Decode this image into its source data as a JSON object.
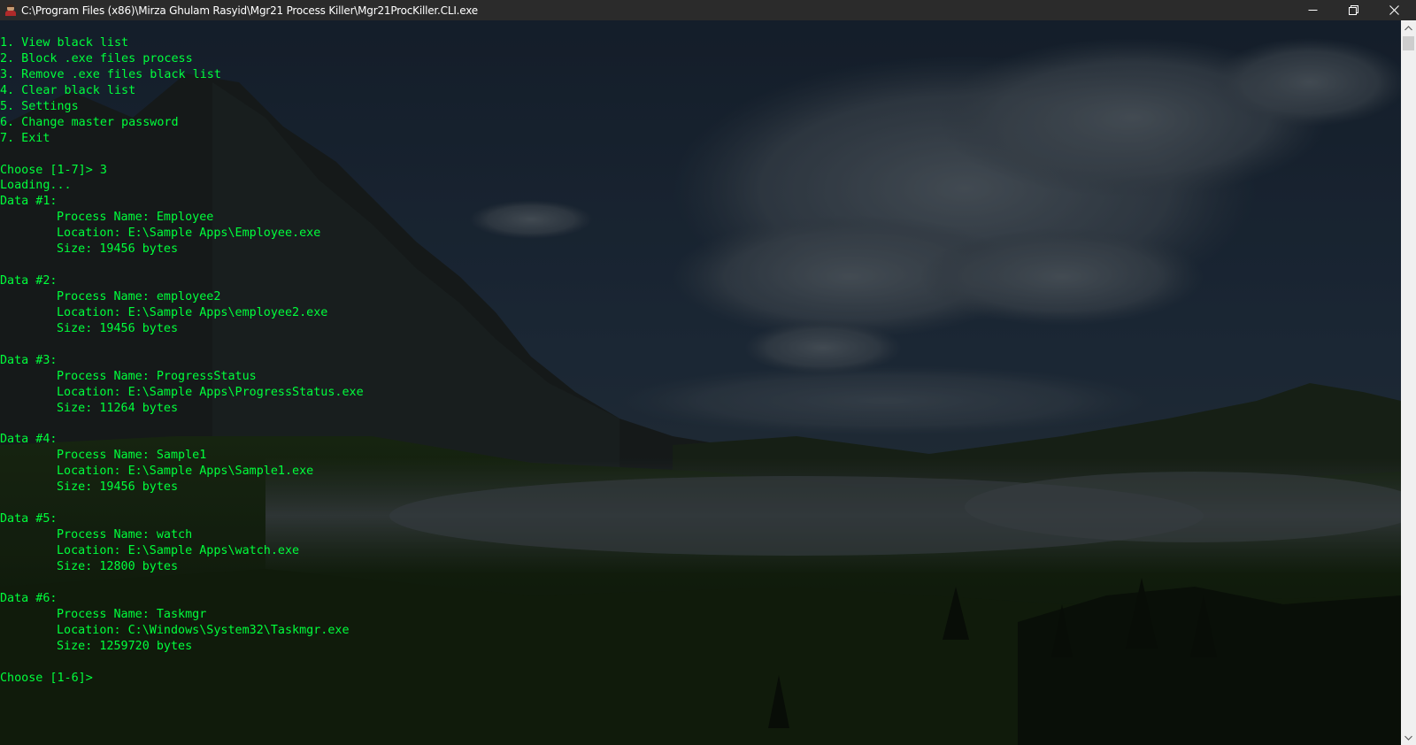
{
  "window": {
    "title": "C:\\Program Files (x86)\\Mirza Ghulam Rasyid\\Mgr21 Process Killer\\Mgr21ProcKiller.CLI.exe",
    "icon": "app-avatar-icon",
    "minimize_icon": "minimize-icon",
    "maximize_icon": "restore-icon",
    "close_icon": "close-icon"
  },
  "colors": {
    "console_text": "#00ff3c",
    "titlebar_bg": "#2b2b2b",
    "scrollbar_bg": "#f0f0f0"
  },
  "console": {
    "menu": [
      "1. View black list",
      "2. Block .exe files process",
      "3. Remove .exe files black list",
      "4. Clear black list",
      "5. Settings",
      "6. Change master password",
      "7. Exit"
    ],
    "prompt_1": "Choose [1-7]> 3",
    "loading": "Loading...",
    "entries": [
      {
        "header": "Data #1:",
        "process_name": "Process Name: Employee",
        "location": "Location: E:\\Sample Apps\\Employee.exe",
        "size": "Size: 19456 bytes"
      },
      {
        "header": "Data #2:",
        "process_name": "Process Name: employee2",
        "location": "Location: E:\\Sample Apps\\employee2.exe",
        "size": "Size: 19456 bytes"
      },
      {
        "header": "Data #3:",
        "process_name": "Process Name: ProgressStatus",
        "location": "Location: E:\\Sample Apps\\ProgressStatus.exe",
        "size": "Size: 11264 bytes"
      },
      {
        "header": "Data #4:",
        "process_name": "Process Name: Sample1",
        "location": "Location: E:\\Sample Apps\\Sample1.exe",
        "size": "Size: 19456 bytes"
      },
      {
        "header": "Data #5:",
        "process_name": "Process Name: watch",
        "location": "Location: E:\\Sample Apps\\watch.exe",
        "size": "Size: 12800 bytes"
      },
      {
        "header": "Data #6:",
        "process_name": "Process Name: Taskmgr",
        "location": "Location: C:\\Windows\\System32\\Taskmgr.exe",
        "size": "Size: 1259720 bytes"
      }
    ],
    "prompt_2": "Choose [1-6]>"
  },
  "scrollbar": {
    "up_icon": "scroll-up-arrow-icon",
    "down_icon": "scroll-down-arrow-icon"
  }
}
